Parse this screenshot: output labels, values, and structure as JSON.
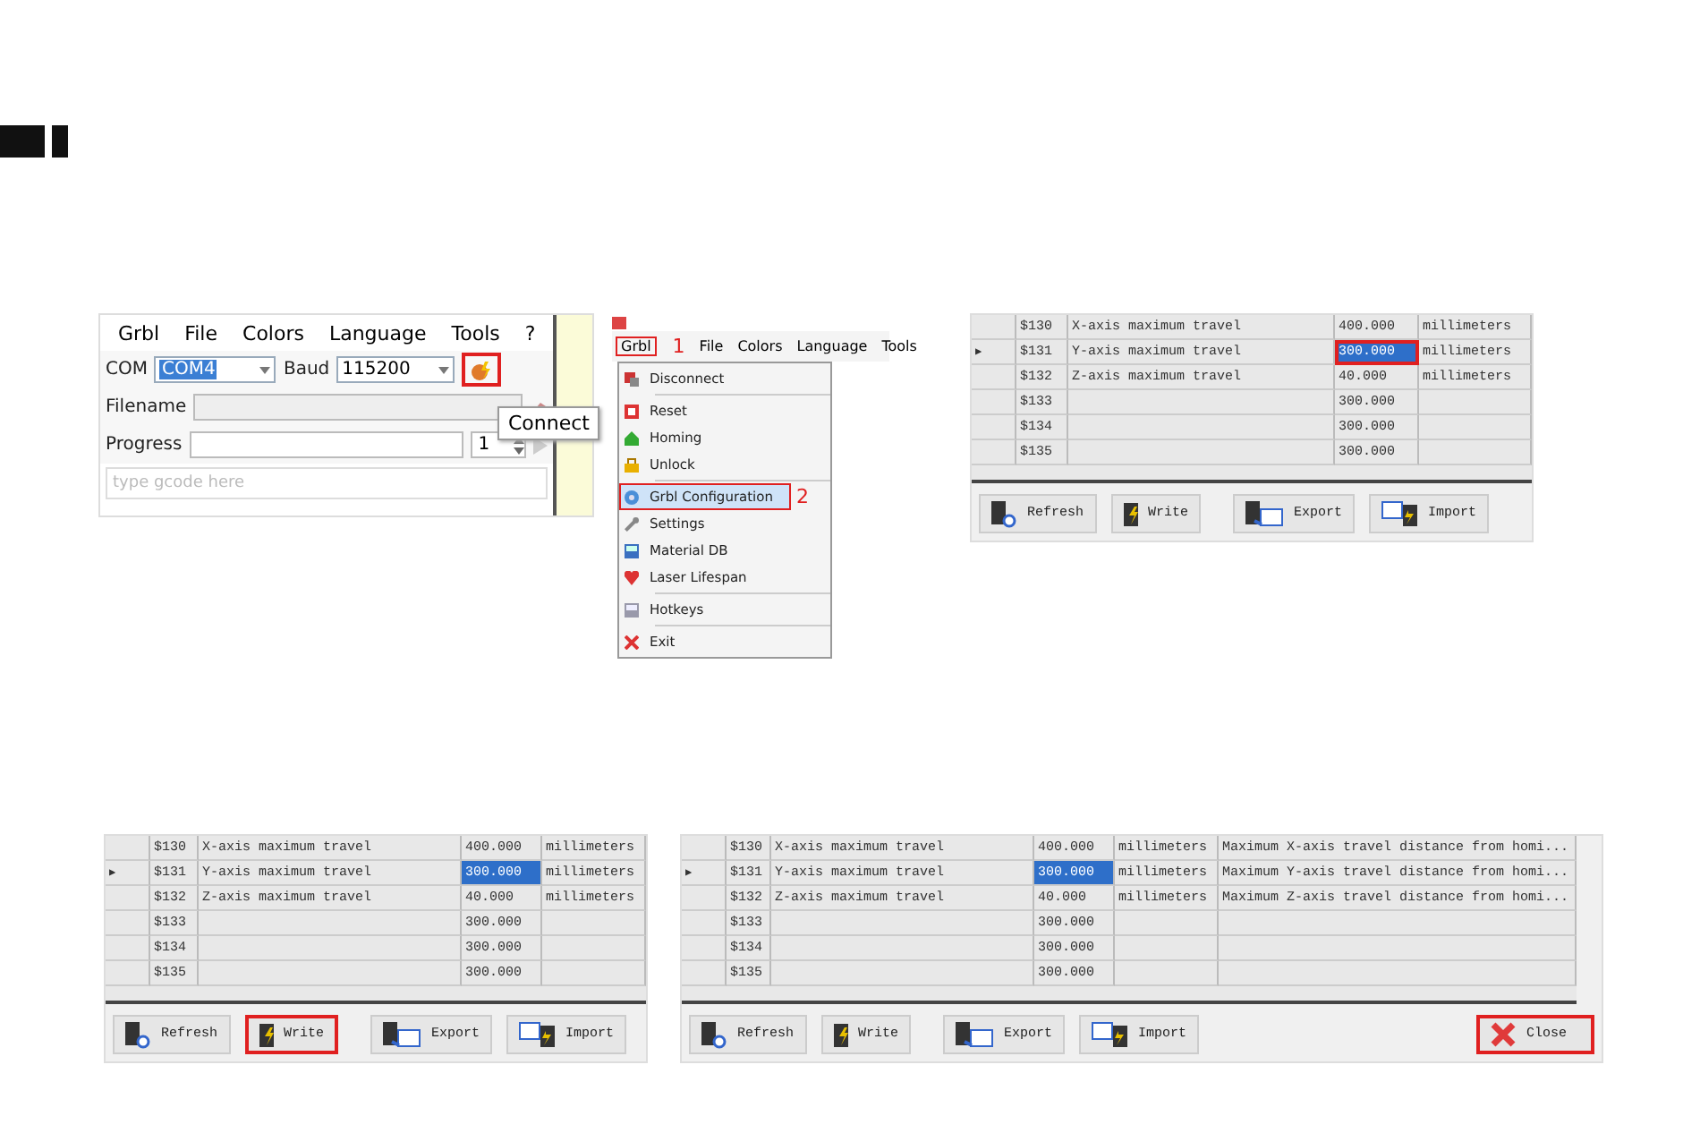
{
  "panels": [
    {
      "kind": "main_window",
      "menu": [
        {
          "label": "Grbl"
        },
        {
          "label": "File"
        },
        {
          "label": "Colors"
        },
        {
          "label": "Language"
        },
        {
          "label": "Tools"
        },
        {
          "label": "?"
        }
      ],
      "port_label": "COM",
      "port": "COM4",
      "baud_label": "Baud",
      "baud": "115200",
      "connect_highlighted": true,
      "tooltip": "Connect",
      "filename_label": "Filename",
      "progress_label": "Progress",
      "copies": "1",
      "gcode_placeholder": "type gcode here"
    },
    {
      "kind": "menu",
      "menu_bar": [
        {
          "label": "Grbl",
          "highlighted": true,
          "callout": "1"
        },
        {
          "label": "File",
          "highlighted": false
        },
        {
          "label": "Colors",
          "highlighted": false
        },
        {
          "label": "Language",
          "highlighted": false
        },
        {
          "label": "Tools",
          "highlighted": false
        }
      ],
      "items": [
        {
          "kind": "item",
          "label": "Disconnect",
          "highlighted": false
        },
        {
          "kind": "separator"
        },
        {
          "kind": "item",
          "label": "Reset",
          "highlighted": false
        },
        {
          "kind": "item",
          "label": "Homing",
          "highlighted": false
        },
        {
          "kind": "item",
          "label": "Unlock",
          "highlighted": false
        },
        {
          "kind": "separator"
        },
        {
          "kind": "item",
          "label": "Grbl Configuration",
          "highlighted": true,
          "callout": "2"
        },
        {
          "kind": "item",
          "label": "Settings",
          "highlighted": false
        },
        {
          "kind": "item",
          "label": "Material DB",
          "highlighted": false
        },
        {
          "kind": "item",
          "label": "Laser Lifespan",
          "highlighted": false
        },
        {
          "kind": "separator"
        },
        {
          "kind": "item",
          "label": "Hotkeys",
          "highlighted": false
        },
        {
          "kind": "separator"
        },
        {
          "kind": "item",
          "label": "Exit",
          "highlighted": false
        }
      ]
    },
    {
      "kind": "config_table",
      "row_pointer": "▶",
      "rows": [
        {
          "cells": [
            "$130",
            "X-axis maximum travel",
            "400.000",
            "millimeters"
          ],
          "current": false,
          "value_selected": false,
          "value_outlined": false
        },
        {
          "cells": [
            "$131",
            "Y-axis maximum travel",
            "300.000",
            "millimeters"
          ],
          "current": true,
          "value_selected": true,
          "value_outlined": true
        },
        {
          "cells": [
            "$132",
            "Z-axis maximum travel",
            "40.000",
            "millimeters"
          ],
          "current": false,
          "value_selected": false,
          "value_outlined": false
        },
        {
          "cells": [
            "$133",
            "",
            "300.000",
            ""
          ],
          "current": false,
          "value_selected": false,
          "value_outlined": false
        },
        {
          "cells": [
            "$134",
            "",
            "300.000",
            ""
          ],
          "current": false,
          "value_selected": false,
          "value_outlined": false
        },
        {
          "cells": [
            "$135",
            "",
            "300.000",
            ""
          ],
          "current": false,
          "value_selected": false,
          "value_outlined": false
        }
      ],
      "buttons": [
        {
          "label": "Refresh",
          "highlighted": false
        },
        {
          "label": "Write",
          "highlighted": false
        },
        {
          "label": "Export",
          "highlighted": false
        },
        {
          "label": "Import",
          "highlighted": false
        }
      ]
    },
    {
      "kind": "config_table",
      "row_pointer": "▶",
      "rows": [
        {
          "cells": [
            "$130",
            "X-axis maximum travel",
            "400.000",
            "millimeters"
          ],
          "current": false,
          "value_selected": false,
          "value_outlined": false
        },
        {
          "cells": [
            "$131",
            "Y-axis maximum travel",
            "300.000",
            "millimeters"
          ],
          "current": true,
          "value_selected": true,
          "value_outlined": false
        },
        {
          "cells": [
            "$132",
            "Z-axis maximum travel",
            "40.000",
            "millimeters"
          ],
          "current": false,
          "value_selected": false,
          "value_outlined": false
        },
        {
          "cells": [
            "$133",
            "",
            "300.000",
            ""
          ],
          "current": false,
          "value_selected": false,
          "value_outlined": false
        },
        {
          "cells": [
            "$134",
            "",
            "300.000",
            ""
          ],
          "current": false,
          "value_selected": false,
          "value_outlined": false
        },
        {
          "cells": [
            "$135",
            "",
            "300.000",
            ""
          ],
          "current": false,
          "value_selected": false,
          "value_outlined": false
        }
      ],
      "buttons": [
        {
          "label": "Refresh",
          "highlighted": false
        },
        {
          "label": "Write",
          "highlighted": true
        },
        {
          "label": "Export",
          "highlighted": false
        },
        {
          "label": "Import",
          "highlighted": false
        }
      ]
    },
    {
      "kind": "config_table",
      "row_pointer": "▶",
      "rows": [
        {
          "cells": [
            "$130",
            "X-axis maximum travel",
            "400.000",
            "millimeters",
            "Maximum X-axis travel distance from homi..."
          ],
          "current": false,
          "value_selected": false,
          "value_outlined": false
        },
        {
          "cells": [
            "$131",
            "Y-axis maximum travel",
            "300.000",
            "millimeters",
            "Maximum Y-axis travel distance from homi..."
          ],
          "current": true,
          "value_selected": true,
          "value_outlined": false
        },
        {
          "cells": [
            "$132",
            "Z-axis maximum travel",
            "40.000",
            "millimeters",
            "Maximum Z-axis travel distance from homi..."
          ],
          "current": false,
          "value_selected": false,
          "value_outlined": false
        },
        {
          "cells": [
            "$133",
            "",
            "300.000",
            "",
            ""
          ],
          "current": false,
          "value_selected": false,
          "value_outlined": false
        },
        {
          "cells": [
            "$134",
            "",
            "300.000",
            "",
            ""
          ],
          "current": false,
          "value_selected": false,
          "value_outlined": false
        },
        {
          "cells": [
            "$135",
            "",
            "300.000",
            "",
            ""
          ],
          "current": false,
          "value_selected": false,
          "value_outlined": false
        }
      ],
      "buttons": [
        {
          "label": "Refresh",
          "highlighted": false
        },
        {
          "label": "Write",
          "highlighted": false
        },
        {
          "label": "Export",
          "highlighted": false
        },
        {
          "label": "Import",
          "highlighted": false
        },
        {
          "label": "Close",
          "highlighted": true
        }
      ]
    }
  ]
}
